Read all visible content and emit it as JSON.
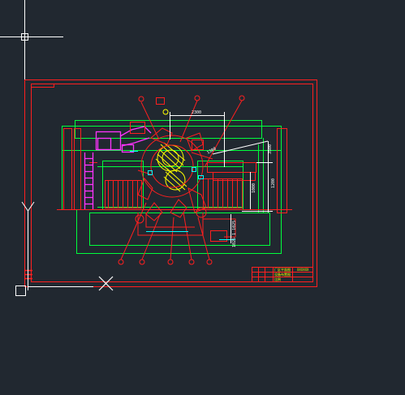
{
  "colors": {
    "background": "#212830",
    "crosshair": "#ffffff",
    "frame": "#ff1f1f",
    "equipment_outline": "#00ff3c",
    "conveyor": "#ff33ff",
    "dimension": "#ffffff",
    "hatch": "#ffff00",
    "cyan_parts": "#00ffff",
    "title_block_text": "#ffff00"
  },
  "icons": {
    "cursor": "crosshair-pickbox",
    "ucs": "ucs-axis-icon",
    "ucs_origin": "ucs-origin-box",
    "x_marker": "x-marker"
  },
  "drawing": {
    "dimensions": {
      "top": "2300",
      "vertical_right_1": "3500",
      "vertical_right_2": "1200",
      "vertical_right_3": "1000",
      "vertical_middle": "1300",
      "lower": "1025 1 1025"
    },
    "title_block": {
      "line1": "厂区平面图",
      "line2": "设备布置图",
      "line3": "比例",
      "code": "XXXXXX"
    }
  }
}
